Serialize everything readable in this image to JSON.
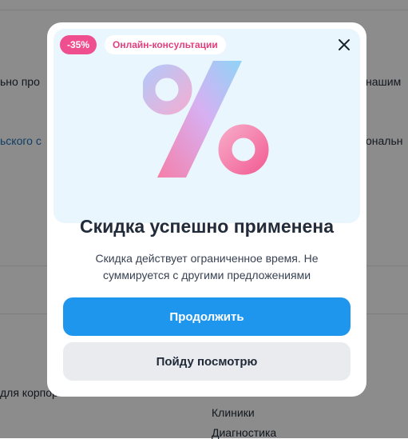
{
  "background": {
    "text_1_left": "ьно про",
    "text_1_right": "нашим",
    "text_2_link": "ьского с",
    "text_2_right": "ональн",
    "text_3": "для корпор",
    "footer_link_1": "Клиники",
    "footer_link_2": "Диагностика"
  },
  "modal": {
    "badge_discount": "-35%",
    "badge_category": "Онлайн-консультации",
    "title": "Скидка успешно применена",
    "subtitle": "Скидка действует ограниченное время. Не суммируется с другими предложениями",
    "primary_button": "Продолжить",
    "secondary_button": "Пойду посмотрю",
    "close_icon": "close-icon",
    "illustration_icon": "percent-icon"
  },
  "colors": {
    "primary": "#1f96ee",
    "badge_pink": "#ef4e8f",
    "banner_bg": "#eaf6fd"
  }
}
